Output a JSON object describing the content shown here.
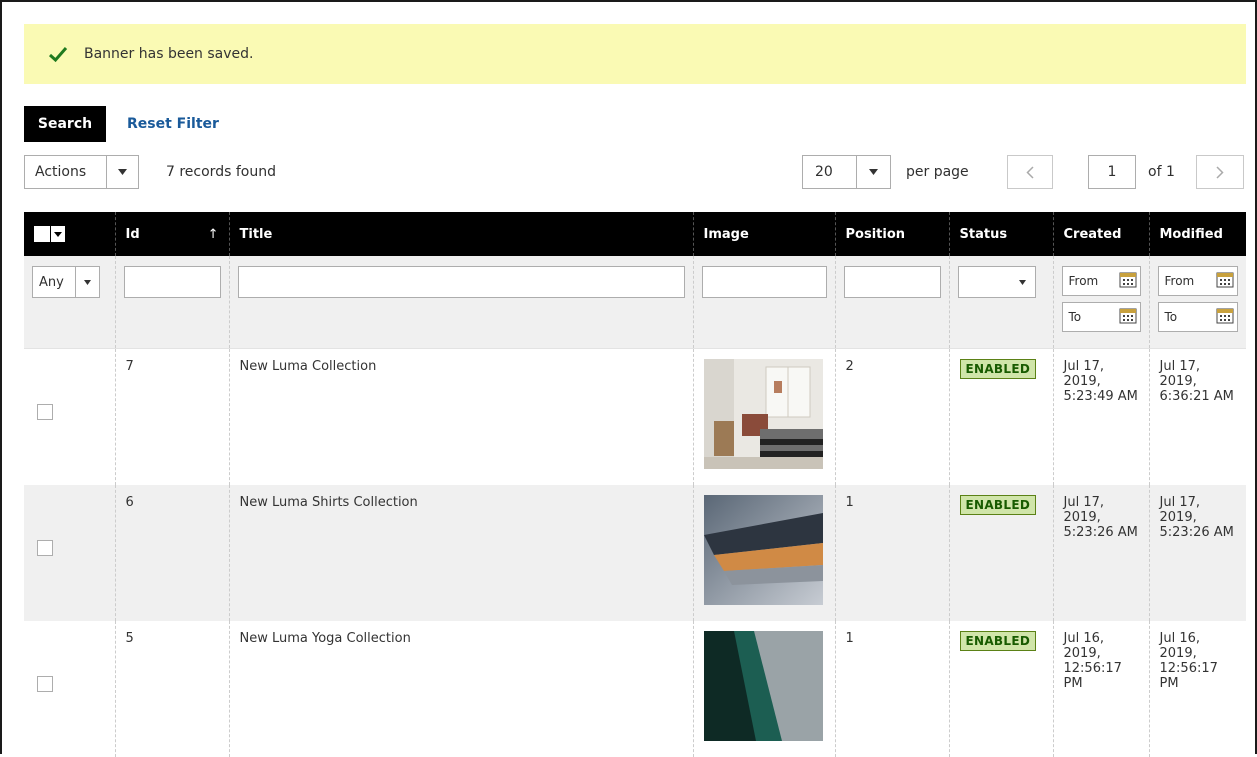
{
  "message": {
    "text": "Banner has been saved."
  },
  "filters": {
    "search_label": "Search",
    "reset_label": "Reset Filter"
  },
  "toolbar": {
    "actions_label": "Actions",
    "records_found": "7 records found",
    "per_page_value": "20",
    "per_page_label": "per page",
    "current_page": "1",
    "page_total": "of 1"
  },
  "grid": {
    "columns": [
      "Id",
      "Title",
      "Image",
      "Position",
      "Status",
      "Created",
      "Modified"
    ],
    "filter": {
      "massaction_value": "Any",
      "from_label": "From",
      "to_label": "To"
    },
    "rows": [
      {
        "id": "7",
        "title": "New Luma Collection",
        "position": "2",
        "status": "ENABLED",
        "created": "Jul 17, 2019, 5:23:49 AM",
        "modified": "Jul 17, 2019, 6:36:21 AM"
      },
      {
        "id": "6",
        "title": "New Luma Shirts Collection",
        "position": "1",
        "status": "ENABLED",
        "created": "Jul 17, 2019, 5:23:26 AM",
        "modified": "Jul 17, 2019, 5:23:26 AM"
      },
      {
        "id": "5",
        "title": "New Luma Yoga Collection",
        "position": "1",
        "status": "ENABLED",
        "created": "Jul 16, 2019, 12:56:17 PM",
        "modified": "Jul 16, 2019, 12:56:17 PM"
      }
    ]
  },
  "colors": {
    "message_bg": "#fafab4",
    "header_bg": "#000000",
    "enabled_bg": "#d0e5a9",
    "link": "#1a5a9a"
  }
}
